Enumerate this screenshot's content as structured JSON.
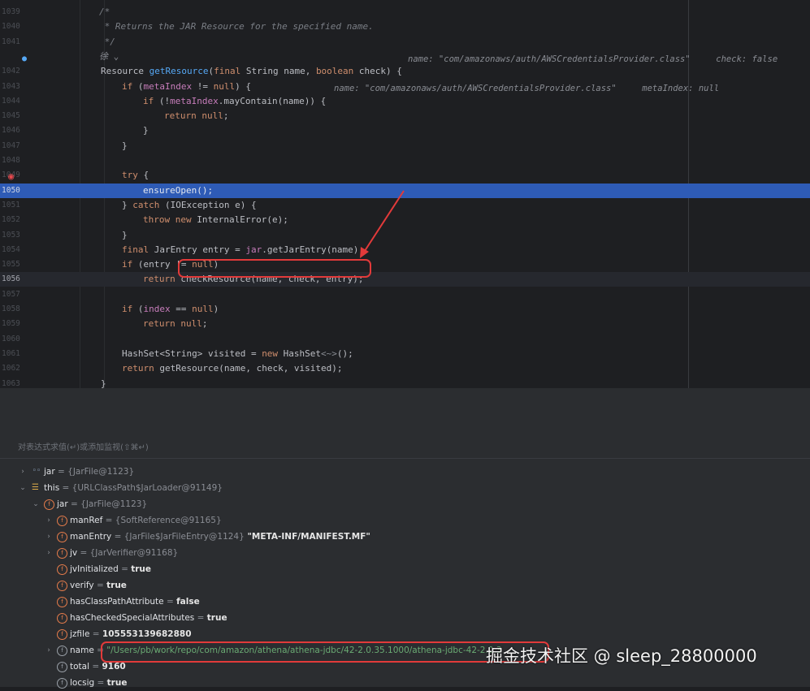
{
  "editor": {
    "lines": [
      {
        "num": "1039",
        "html": "<span class=\"cmt\">/*</span>",
        "indent": 122
      },
      {
        "num": "1040",
        "html": "<span class=\"cmt\"> * Returns the JAR Resource for the specified name.</span>",
        "indent": 122
      },
      {
        "num": "1041",
        "html": "<span class=\"cmt\"> */</span>",
        "indent": 122
      },
      {
        "num": "",
        "html": "<span class=\"hint\">徐 ⌄</span>",
        "indent": 122
      },
      {
        "num": "1042",
        "html": "Resource <span class=\"fn\">getResource</span>(<span class=\"kw\">final</span> String name, <span class=\"kw\">boolean</span> check) {",
        "indent": 124
      },
      {
        "num": "1043",
        "html": "<span class=\"kw\">if</span> (<span class=\"fld\">metaIndex</span> != <span class=\"kw\">null</span>) {",
        "indent": 150
      },
      {
        "num": "1044",
        "html": "<span class=\"kw\">if</span> (!<span class=\"fld\">metaIndex</span>.mayContain(name)) {",
        "indent": 176
      },
      {
        "num": "1045",
        "html": "<span class=\"kw\">return null</span>;",
        "indent": 202
      },
      {
        "num": "1046",
        "html": "}",
        "indent": 176
      },
      {
        "num": "1047",
        "html": "}",
        "indent": 150
      },
      {
        "num": "1048",
        "html": "",
        "indent": 150
      },
      {
        "num": "1049",
        "html": "<span class=\"kw\">try</span> {",
        "indent": 150
      },
      {
        "num": "1050",
        "html": "ensureOpen();",
        "indent": 176
      },
      {
        "num": "1051",
        "html": "} <span class=\"kw\">catch</span> (IOException e) {",
        "indent": 150
      },
      {
        "num": "1052",
        "html": "<span class=\"kw\">throw new</span> InternalError(e);",
        "indent": 176
      },
      {
        "num": "1053",
        "html": "}",
        "indent": 150
      },
      {
        "num": "1054",
        "html": "<span class=\"kw\">final</span> JarEntry entry = <span class=\"fld\">jar</span>.getJarEntry(name);",
        "indent": 150
      },
      {
        "num": "1055",
        "html": "<span class=\"kw\">if</span> (entry != <span class=\"kw\">null</span>)",
        "indent": 150
      },
      {
        "num": "1056",
        "html": "<span class=\"kw\">return</span> checkResource(name, check, entry);",
        "indent": 176
      },
      {
        "num": "1057",
        "html": "",
        "indent": 150
      },
      {
        "num": "1058",
        "html": "<span class=\"kw\">if</span> (<span class=\"fld\">index</span> == <span class=\"kw\">null</span>)",
        "indent": 150
      },
      {
        "num": "1059",
        "html": "<span class=\"kw\">return null</span>;",
        "indent": 176
      },
      {
        "num": "1060",
        "html": "",
        "indent": 150
      },
      {
        "num": "1061",
        "html": "HashSet&lt;String&gt; visited = <span class=\"kw\">new</span> HashSet<span class=\"hint\">&lt;~&gt;</span>();",
        "indent": 150
      },
      {
        "num": "1062",
        "html": "<span class=\"kw\">return</span> getResource(name, check, visited);",
        "indent": 150
      },
      {
        "num": "1063",
        "html": "}",
        "indent": 124
      }
    ],
    "inline_hints": {
      "line_1042": "name: \"com/amazonaws/auth/AWSCredentialsProvider.class\"     check: false",
      "line_1044": "name: \"com/amazonaws/auth/AWSCredentialsProvider.class\"     metaIndex: null"
    }
  },
  "panel": {
    "eval_placeholder": "对表达式求值(↵)或添加监视(⇧⌘↵)",
    "variables": [
      {
        "depth": 0,
        "toggle": "›",
        "icon": "glasses",
        "name": "jar",
        "eq": " = ",
        "value": "{JarFile@1123}",
        "string": ""
      },
      {
        "depth": 0,
        "toggle": "⌄",
        "icon": "lines",
        "name": "this",
        "eq": " = ",
        "value": "{URLClassPath$JarLoader@91149}",
        "string": ""
      },
      {
        "depth": 1,
        "toggle": "⌄",
        "icon": "field",
        "name": "jar",
        "eq": " = ",
        "value": "{JarFile@1123}",
        "string": ""
      },
      {
        "depth": 2,
        "toggle": "›",
        "icon": "field",
        "name": "manRef",
        "eq": " = ",
        "value": "{SoftReference@91165}",
        "string": ""
      },
      {
        "depth": 2,
        "toggle": "›",
        "icon": "field",
        "name": "manEntry",
        "eq": " = ",
        "value": "{JarFile$JarFileEntry@1124}",
        "string": " \"META-INF/MANIFEST.MF\""
      },
      {
        "depth": 2,
        "toggle": "›",
        "icon": "field",
        "name": "jv",
        "eq": " = ",
        "value": "{JarVerifier@91168}",
        "string": ""
      },
      {
        "depth": 2,
        "toggle": "",
        "icon": "field",
        "name": "jvInitialized",
        "eq": " = ",
        "value": "",
        "string": "true"
      },
      {
        "depth": 2,
        "toggle": "",
        "icon": "field",
        "name": "verify",
        "eq": " = ",
        "value": "",
        "string": "true"
      },
      {
        "depth": 2,
        "toggle": "",
        "icon": "field",
        "name": "hasClassPathAttribute",
        "eq": " = ",
        "value": "",
        "string": "false"
      },
      {
        "depth": 2,
        "toggle": "",
        "icon": "field",
        "name": "hasCheckedSpecialAttributes",
        "eq": " = ",
        "value": "",
        "string": "true"
      },
      {
        "depth": 2,
        "toggle": "",
        "icon": "field",
        "name": "jzfile",
        "eq": " = ",
        "value": "",
        "string": "105553139682880"
      },
      {
        "depth": 2,
        "toggle": "›",
        "icon": "pin",
        "name": "name",
        "eq": " = ",
        "value": "",
        "string": "",
        "path": "\"/Users/pb/work/repo/com/amazon/athena/athena-jdbc/42-2.0.35.1000/athena-jdbc-42-2.0.3"
      },
      {
        "depth": 2,
        "toggle": "",
        "icon": "pin",
        "name": "total",
        "eq": " = ",
        "value": "",
        "string": "9160"
      },
      {
        "depth": 2,
        "toggle": "",
        "icon": "pin",
        "name": "locsig",
        "eq": " = ",
        "value": "",
        "string": "true"
      }
    ]
  },
  "watermark": "掘金技术社区 @ sleep_28800000",
  "colors": {
    "accent_exec_line": "#2e5bb6",
    "callout": "#e23a3a",
    "keyword": "#cf8e6d"
  }
}
